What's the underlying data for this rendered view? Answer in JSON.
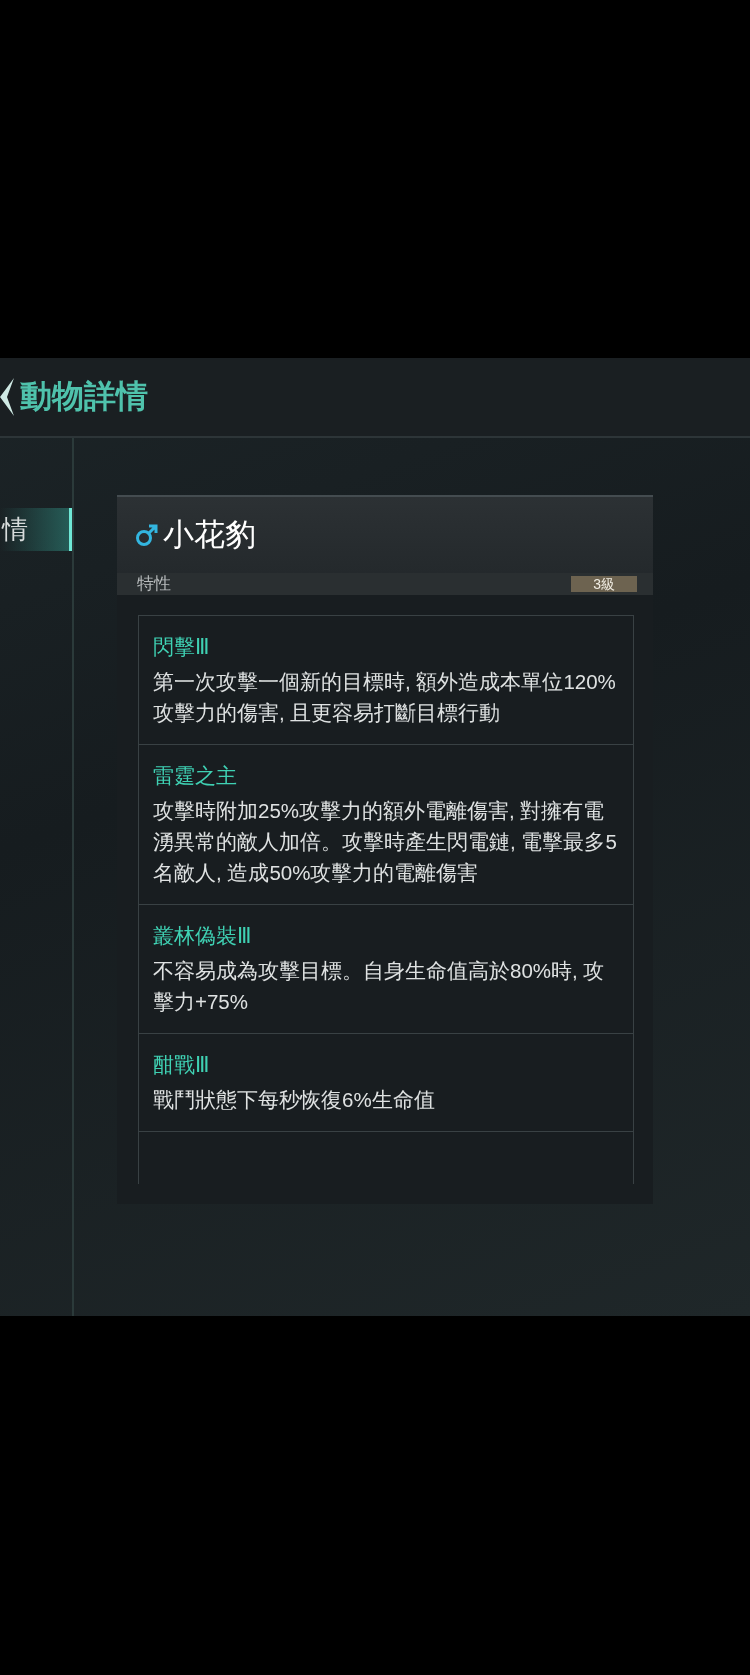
{
  "header": {
    "title": "動物詳情"
  },
  "sidebar": {
    "tabs": [
      {
        "label": "情",
        "selected": true
      }
    ]
  },
  "card": {
    "name": "小花豹",
    "trait_row": {
      "label": "特性",
      "level": "3級"
    },
    "traits": [
      {
        "name": "閃擊Ⅲ",
        "description": "第一次攻擊一個新的目標時, 額外造成本單位120%攻擊力的傷害, 且更容易打斷目標行動"
      },
      {
        "name": "雷霆之主",
        "description": "攻擊時附加25%攻擊力的額外電離傷害, 對擁有電湧異常的敵人加倍。攻擊時產生閃電鏈, 電擊最多5名敵人, 造成50%攻擊力的電離傷害"
      },
      {
        "name": "叢林偽裝Ⅲ",
        "description": "不容易成為攻擊目標。自身生命值高於80%時, 攻擊力+75%"
      },
      {
        "name": "酣戰Ⅲ",
        "description": "戰鬥狀態下每秒恢復6%生命值"
      }
    ]
  }
}
